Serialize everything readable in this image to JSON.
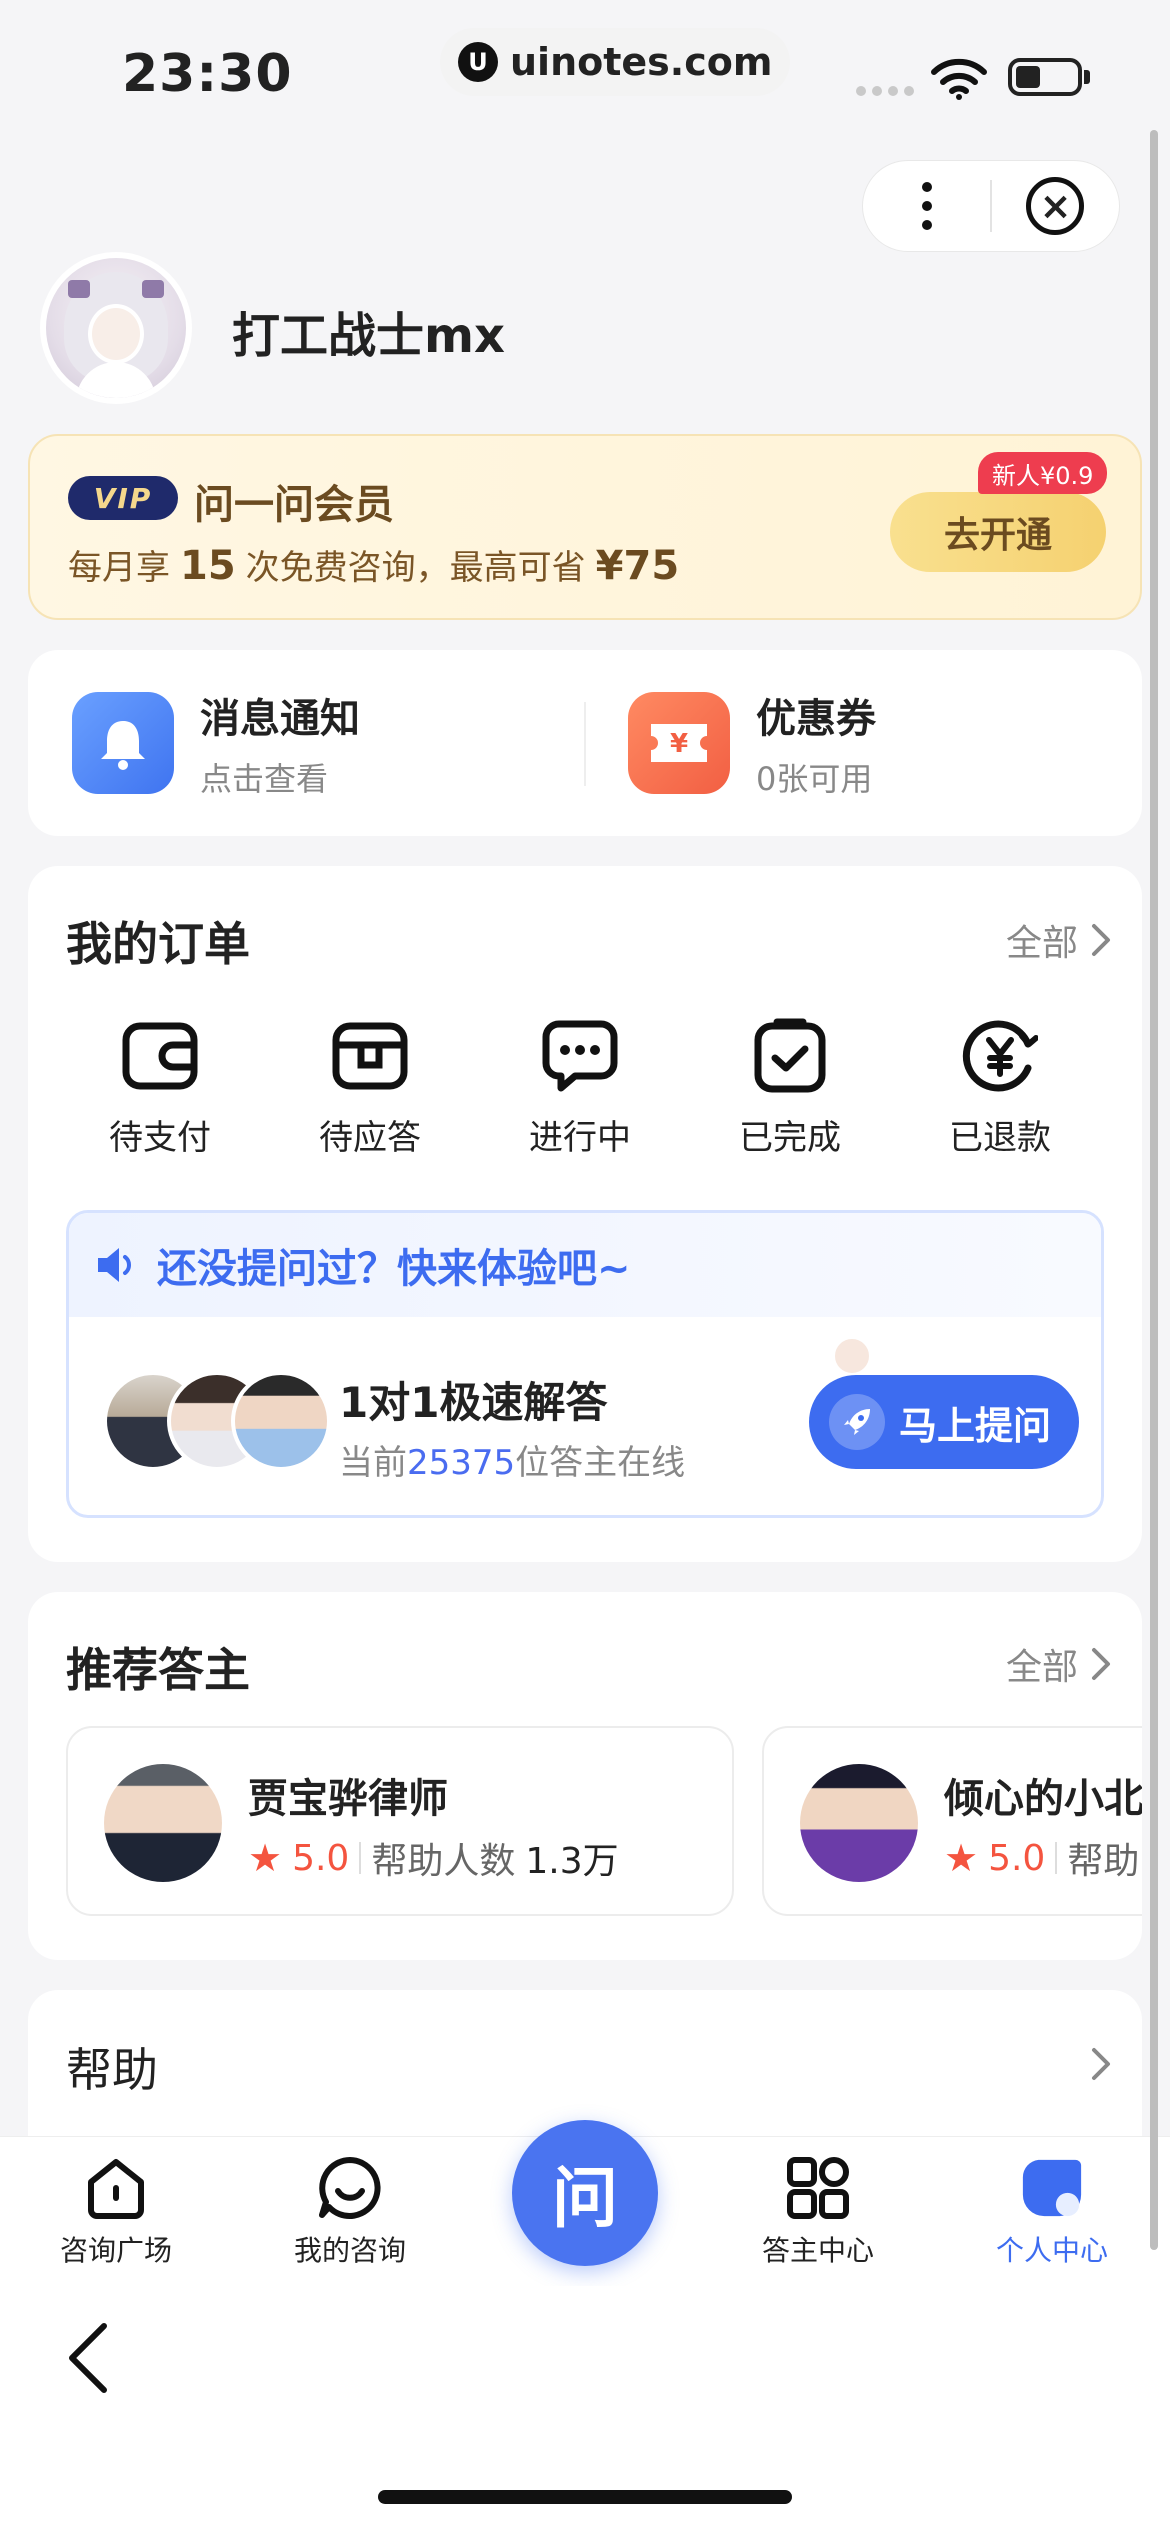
{
  "status_bar": {
    "time": "23:30",
    "url": "uinotes.com",
    "url_logo_glyph": "U"
  },
  "capsule": {
    "more_icon": "more-dots-icon",
    "close_icon": "close-circle-icon"
  },
  "profile": {
    "username": "打工战士mx"
  },
  "vip": {
    "badge": "VIP",
    "title": "问一问会员",
    "desc_prefix": "每月享",
    "desc_count": "15",
    "desc_middle": "次免费咨询，最高可省",
    "desc_amount": "¥75",
    "tag": "新人¥0.9",
    "button": "去开通",
    "colors": {
      "badge_bg": "#1f2a6b",
      "button_bg": "#f5d170",
      "tag_bg": "#ee3d4f"
    }
  },
  "notices": {
    "messages": {
      "title": "消息通知",
      "sub": "点击查看",
      "icon": "bell-icon"
    },
    "coupons": {
      "title": "优惠券",
      "sub": "0张可用",
      "icon": "coupon-icon"
    }
  },
  "orders": {
    "title": "我的订单",
    "see_all": "全部",
    "items": [
      {
        "label": "待支付",
        "icon": "wallet-icon"
      },
      {
        "label": "待应答",
        "icon": "inbox-icon"
      },
      {
        "label": "进行中",
        "icon": "chat-bubble-icon"
      },
      {
        "label": "已完成",
        "icon": "clipboard-check-icon"
      },
      {
        "label": "已退款",
        "icon": "refund-yen-icon"
      }
    ],
    "ask_box": {
      "headline": "还没提问过？快来体验吧~",
      "title": "1对1极速解答",
      "sub_prefix": "当前",
      "online_count": "25375",
      "sub_suffix": "位答主在线",
      "button": "马上提问"
    }
  },
  "recommend": {
    "title": "推荐答主",
    "see_all": "全部",
    "experts": [
      {
        "name": "贾宝骅律师",
        "rating": "5.0",
        "helped_label": "帮助人数",
        "helped_count": "1.3万"
      },
      {
        "name": "倾心的小北",
        "rating": "5.0",
        "helped_label": "帮助",
        "helped_count": ""
      }
    ]
  },
  "help": {
    "title": "帮助"
  },
  "tabbar": {
    "tabs": [
      {
        "label": "咨询广场",
        "icon": "house-icon"
      },
      {
        "label": "我的咨询",
        "icon": "chat-smile-icon"
      },
      {
        "label": "答主中心",
        "icon": "grid-apps-icon"
      },
      {
        "label": "个人中心",
        "icon": "profile-blob-icon",
        "active": true
      }
    ],
    "center_label": "问",
    "active_color": "#3d6cf0"
  }
}
